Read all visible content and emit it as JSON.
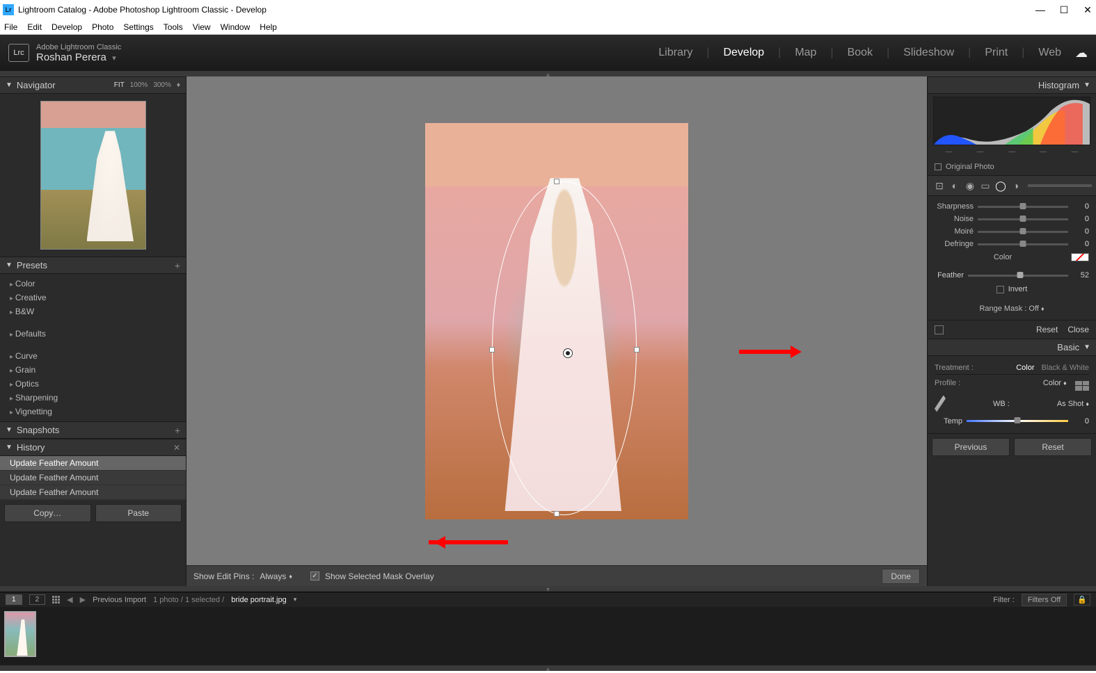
{
  "window": {
    "title": "Lightroom Catalog - Adobe Photoshop Lightroom Classic - Develop"
  },
  "menu": [
    "File",
    "Edit",
    "Develop",
    "Photo",
    "Settings",
    "Tools",
    "View",
    "Window",
    "Help"
  ],
  "identity": {
    "app": "Adobe Lightroom Classic",
    "user": "Roshan Perera",
    "badge": "Lrc"
  },
  "modules": {
    "items": [
      "Library",
      "Develop",
      "Map",
      "Book",
      "Slideshow",
      "Print",
      "Web"
    ],
    "active": "Develop"
  },
  "navigator": {
    "title": "Navigator",
    "fit": "FIT",
    "z100": "100%",
    "z300": "300%"
  },
  "presets": {
    "title": "Presets",
    "group1": [
      "Color",
      "Creative",
      "B&W"
    ],
    "group2": [
      "Defaults"
    ],
    "group3": [
      "Curve",
      "Grain",
      "Optics",
      "Sharpening",
      "Vignetting"
    ]
  },
  "snapshots": {
    "title": "Snapshots"
  },
  "history": {
    "title": "History",
    "rows": [
      "Update Feather Amount",
      "Update Feather Amount",
      "Update Feather Amount"
    ]
  },
  "copypaste": {
    "copy": "Copy…",
    "paste": "Paste"
  },
  "centerbar": {
    "show_edit_pins": "Show Edit Pins :",
    "pins_mode": "Always",
    "overlay_label": "Show Selected Mask Overlay",
    "overlay_checked": true,
    "done": "Done"
  },
  "histogram": {
    "title": "Histogram",
    "original": "Original Photo"
  },
  "tools": {
    "active": "radial"
  },
  "adjust": {
    "sliders": [
      {
        "label": "Sharpness",
        "value": 0,
        "pos": 50
      },
      {
        "label": "Noise",
        "value": 0,
        "pos": 50
      },
      {
        "label": "Moiré",
        "value": 0,
        "pos": 50
      },
      {
        "label": "Defringe",
        "value": 0,
        "pos": 50
      }
    ],
    "color_label": "Color"
  },
  "feather": {
    "label": "Feather",
    "value": 52,
    "pos": 52
  },
  "invert": {
    "label": "Invert",
    "checked": false
  },
  "rangemask": {
    "label": "Range Mask :",
    "value": "Off"
  },
  "resetclose": {
    "reset": "Reset",
    "close": "Close"
  },
  "basic": {
    "title": "Basic",
    "treatment_label": "Treatment :",
    "treatment_opts": [
      "Color",
      "Black & White"
    ],
    "treatment_active": "Color",
    "profile_label": "Profile :",
    "profile_value": "Color",
    "wb_label": "WB :",
    "wb_value": "As Shot",
    "temp_label": "Temp",
    "temp_value": 0
  },
  "prevreset": {
    "prev": "Previous",
    "reset": "Reset"
  },
  "bottom": {
    "pages": [
      "1",
      "2"
    ],
    "prev_import": "Previous Import",
    "count": "1 photo  / 1 selected  /",
    "filename": "bride portrait.jpg",
    "filter_label": "Filter :",
    "filter_value": "Filters Off"
  }
}
